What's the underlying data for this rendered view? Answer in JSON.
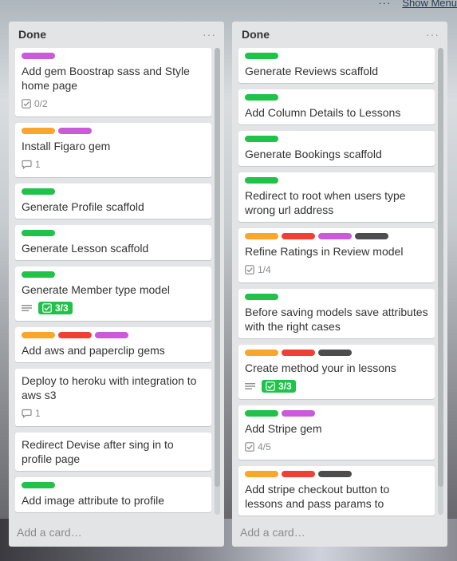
{
  "topbar": {
    "more": "···",
    "show_menu": "Show Menu"
  },
  "lists": [
    {
      "title": "Done",
      "menu": "···",
      "add_card": "Add a card…",
      "cards": [
        {
          "labels": [
            "purple"
          ],
          "title": "Add gem Boostrap sass and Style home page",
          "checklist": "0/2"
        },
        {
          "labels": [
            "orange",
            "purple"
          ],
          "title": "Install Figaro gem",
          "comments": "1"
        },
        {
          "labels": [
            "green"
          ],
          "title": "Generate Profile scaffold"
        },
        {
          "labels": [
            "green"
          ],
          "title": "Generate Lesson scaffold"
        },
        {
          "labels": [
            "green"
          ],
          "title": "Generate Member type model",
          "description": true,
          "checklist_done": "3/3"
        },
        {
          "labels": [
            "orange",
            "red",
            "purple"
          ],
          "title": "Add aws and paperclip gems"
        },
        {
          "labels": [],
          "title": "Deploy to heroku with integration to aws s3",
          "comments": "1"
        },
        {
          "labels": [],
          "title": "Redirect Devise after sing in to profile page"
        },
        {
          "labels": [
            "green"
          ],
          "title": "Add image attribute to profile"
        }
      ]
    },
    {
      "title": "Done",
      "menu": "···",
      "add_card": "Add a card…",
      "cards": [
        {
          "labels": [
            "green"
          ],
          "title": "Generate Reviews scaffold"
        },
        {
          "labels": [
            "green"
          ],
          "title": "Add Column Details to Lessons"
        },
        {
          "labels": [
            "green"
          ],
          "title": "Generate Bookings scaffold"
        },
        {
          "labels": [
            "green"
          ],
          "title": "Redirect to root when users type wrong url address"
        },
        {
          "labels": [
            "orange",
            "red",
            "purple",
            "black"
          ],
          "title": "Refine Ratings in Review model",
          "checklist": "1/4"
        },
        {
          "labels": [
            "green"
          ],
          "title": "Before saving models save attributes with the right cases"
        },
        {
          "labels": [
            "orange",
            "red",
            "black"
          ],
          "title": "Create method your in lessons",
          "description": true,
          "checklist_done": "3/3"
        },
        {
          "labels": [
            "green",
            "purple"
          ],
          "title": "Add Stripe gem",
          "checklist": "4/5"
        },
        {
          "labels": [
            "orange",
            "red",
            "black"
          ],
          "title": "Add stripe checkout button to lessons and pass params to"
        }
      ]
    }
  ],
  "colors": {
    "green": "#21c24a",
    "purple": "#c95ad8",
    "orange": "#f8a62c",
    "red": "#ef4035",
    "black": "#4d4d4d",
    "list_bg": "#e2e4e6"
  },
  "icons": {
    "checklist": "checklist-icon",
    "comment": "comment-icon",
    "description": "description-icon"
  }
}
